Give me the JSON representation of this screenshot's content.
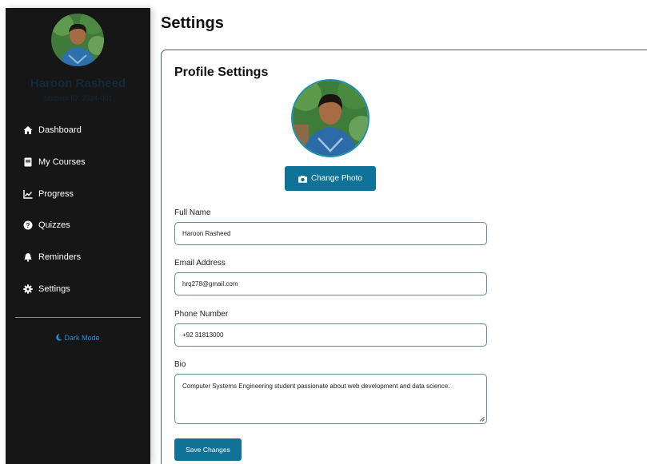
{
  "sidebar": {
    "user_name": "Haroon Rasheed",
    "user_subtitle": "Student ID: 2024-001",
    "nav": [
      {
        "label": "Dashboard",
        "icon": "home-icon"
      },
      {
        "label": "My Courses",
        "icon": "book-icon"
      },
      {
        "label": "Progress",
        "icon": "chart-line-icon"
      },
      {
        "label": "Quizzes",
        "icon": "question-circle-icon"
      },
      {
        "label": "Reminders",
        "icon": "bell-icon"
      },
      {
        "label": "Settings",
        "icon": "gear-icon"
      }
    ],
    "dark_mode_label": "Dark Mode"
  },
  "main": {
    "page_title": "Settings",
    "card_title": "Profile Settings",
    "change_photo_label": "Change Photo",
    "fields": {
      "full_name": {
        "label": "Full Name",
        "value": "Haroon Rasheed"
      },
      "email": {
        "label": "Email Address",
        "value": "hrq278@gmail.com"
      },
      "phone": {
        "label": "Phone Number",
        "value": "+92 31813000"
      },
      "bio": {
        "label": "Bio",
        "value": "Computer Systems Engineering student passionate about web development and data science."
      }
    },
    "save_label": "Save Changes"
  },
  "colors": {
    "sidebar_bg": "#161616",
    "accent": "#0e7396",
    "dark_mode_link": "#1e8fd6"
  }
}
